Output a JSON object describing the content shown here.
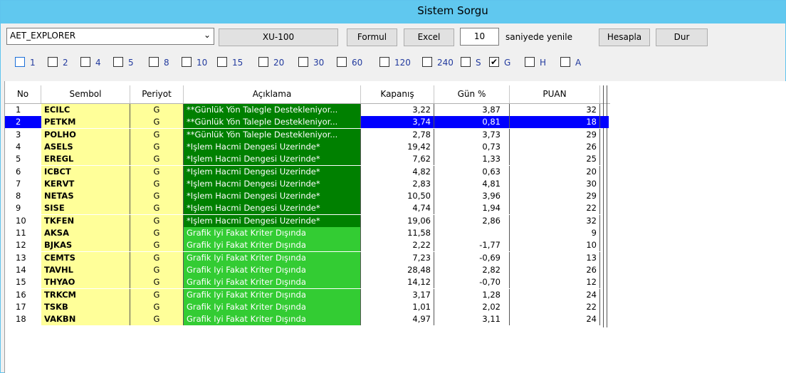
{
  "window": {
    "title": "Sistem Sorgu"
  },
  "toolbar": {
    "template_select": "AET_EXPLORER",
    "index_button": "XU-100",
    "formula_button": "Formul",
    "excel_button": "Excel",
    "refresh_seconds": "10",
    "refresh_label": "saniyede yenile",
    "calculate_button": "Hesapla",
    "stop_button": "Dur"
  },
  "periods": [
    {
      "label": "1",
      "checked": false
    },
    {
      "label": "2",
      "checked": false
    },
    {
      "label": "4",
      "checked": false
    },
    {
      "label": "5",
      "checked": false
    },
    {
      "label": "8",
      "checked": false
    },
    {
      "label": "10",
      "checked": false
    },
    {
      "label": "15",
      "checked": false
    },
    {
      "label": "20",
      "checked": false
    },
    {
      "label": "30",
      "checked": false
    },
    {
      "label": "60",
      "checked": false
    },
    {
      "label": "120",
      "checked": false
    },
    {
      "label": "240",
      "checked": false
    },
    {
      "label": "S",
      "checked": false
    },
    {
      "label": "G",
      "checked": true
    },
    {
      "label": "H",
      "checked": false
    },
    {
      "label": "A",
      "checked": false
    }
  ],
  "table": {
    "columns": [
      "No",
      "Sembol",
      "Periyot",
      "Açıklama",
      "Kapanış",
      "Gün %",
      "PUAN"
    ],
    "selected_row": 2,
    "desc_colors": {
      "dark": "#008000",
      "light": "#33cc33"
    },
    "rows": [
      {
        "no": "1",
        "sym": "ECILC",
        "per": "G",
        "desc": "**Günlük Yön Talegle Destekleniyor...",
        "kap": "3,22",
        "gun": "3,87",
        "puan": "32",
        "tone": "dark"
      },
      {
        "no": "2",
        "sym": "PETKM",
        "per": "G",
        "desc": "**Günlük Yön Taleple Destekleniyor...",
        "kap": "3,74",
        "gun": "0,81",
        "puan": "18",
        "tone": "dark"
      },
      {
        "no": "3",
        "sym": "POLHO",
        "per": "G",
        "desc": "**Günlük Yön Taleple Destekleniyor...",
        "kap": "2,78",
        "gun": "3,73",
        "puan": "29",
        "tone": "dark"
      },
      {
        "no": "4",
        "sym": "ASELS",
        "per": "G",
        "desc": "*Işlem Hacmi Dengesi Uzerinde*",
        "kap": "19,42",
        "gun": "0,73",
        "puan": "26",
        "tone": "dark"
      },
      {
        "no": "5",
        "sym": "EREGL",
        "per": "G",
        "desc": "*Işlem Hacmi Dengesi Uzerinde*",
        "kap": "7,62",
        "gun": "1,33",
        "puan": "25",
        "tone": "dark"
      },
      {
        "no": "6",
        "sym": "ICBCT",
        "per": "G",
        "desc": "*Işlem Hacmi Dengesi Uzerinde*",
        "kap": "4,82",
        "gun": "0,63",
        "puan": "20",
        "tone": "dark"
      },
      {
        "no": "7",
        "sym": "KERVT",
        "per": "G",
        "desc": "*Işlem Hacmi Dengesi Uzerinde*",
        "kap": "2,83",
        "gun": "4,81",
        "puan": "30",
        "tone": "dark"
      },
      {
        "no": "8",
        "sym": "NETAS",
        "per": "G",
        "desc": "*Işlem Hacmi Dengesi Uzerinde*",
        "kap": "10,50",
        "gun": "3,96",
        "puan": "29",
        "tone": "dark"
      },
      {
        "no": "9",
        "sym": "SISE",
        "per": "G",
        "desc": "*Işlem Hacmi Dengesi Uzerinde*",
        "kap": "4,74",
        "gun": "1,94",
        "puan": "22",
        "tone": "dark"
      },
      {
        "no": "10",
        "sym": "TKFEN",
        "per": "G",
        "desc": "*Işlem Hacmi Dengesi Uzerinde*",
        "kap": "19,06",
        "gun": "2,86",
        "puan": "32",
        "tone": "dark"
      },
      {
        "no": "11",
        "sym": "AKSA",
        "per": "G",
        "desc": "Grafik Iyi Fakat Kriter Dışında",
        "kap": "11,58",
        "gun": "",
        "puan": "9",
        "tone": "light"
      },
      {
        "no": "12",
        "sym": "BJKAS",
        "per": "G",
        "desc": "Grafik Iyi Fakat Kriter Dışında",
        "kap": "2,22",
        "gun": "-1,77",
        "puan": "10",
        "tone": "light"
      },
      {
        "no": "13",
        "sym": "CEMTS",
        "per": "G",
        "desc": "Grafik Iyi Fakat Kriter Dışında",
        "kap": "7,23",
        "gun": "-0,69",
        "puan": "13",
        "tone": "light"
      },
      {
        "no": "14",
        "sym": "TAVHL",
        "per": "G",
        "desc": "Grafik Iyi Fakat Kriter Dışında",
        "kap": "28,48",
        "gun": "2,82",
        "puan": "26",
        "tone": "light"
      },
      {
        "no": "15",
        "sym": "THYAO",
        "per": "G",
        "desc": "Grafik Iyi Fakat Kriter Dışında",
        "kap": "14,12",
        "gun": "-0,70",
        "puan": "12",
        "tone": "light"
      },
      {
        "no": "16",
        "sym": "TRKCM",
        "per": "G",
        "desc": "Grafik Iyi Fakat Kriter Dışında",
        "kap": "3,17",
        "gun": "1,28",
        "puan": "24",
        "tone": "light"
      },
      {
        "no": "17",
        "sym": "TSKB",
        "per": "G",
        "desc": "Grafik Iyi Fakat Kriter Dışında",
        "kap": "1,01",
        "gun": "2,02",
        "puan": "22",
        "tone": "light"
      },
      {
        "no": "18",
        "sym": "VAKBN",
        "per": "G",
        "desc": "Grafik Iyi Fakat Kriter Dışında",
        "kap": "4,97",
        "gun": "3,11",
        "puan": "24",
        "tone": "light"
      }
    ]
  }
}
